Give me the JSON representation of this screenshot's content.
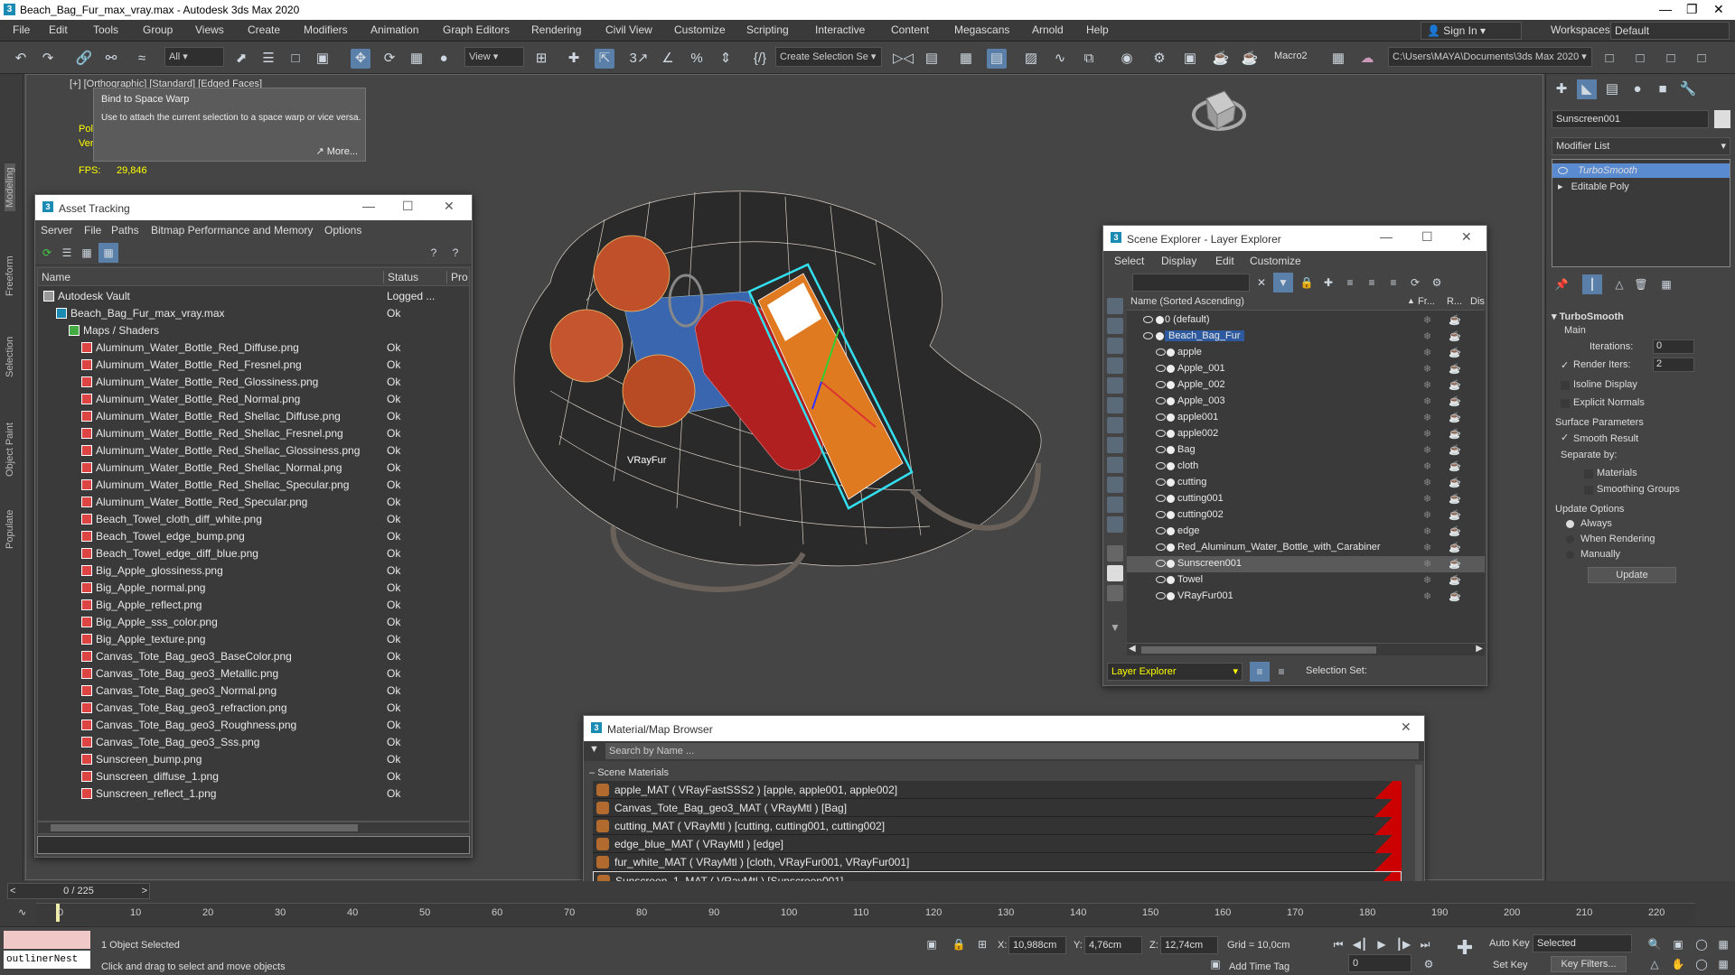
{
  "app": {
    "title": "Beach_Bag_Fur_max_vray.max - Autodesk 3ds Max 2020"
  },
  "menu": [
    "File",
    "Edit",
    "Tools",
    "Group",
    "Views",
    "Create",
    "Modifiers",
    "Animation",
    "Graph Editors",
    "Rendering",
    "Civil View",
    "Customize",
    "Scripting",
    "Interactive",
    "Content",
    "Megascans",
    "Arnold",
    "Help"
  ],
  "account": {
    "sign_in": "Sign In",
    "workspaces_label": "Workspaces:",
    "workspace": "Default"
  },
  "toolbar": {
    "filter": "All",
    "ref_coord": "View",
    "selection_set": "Create Selection Se",
    "macro": "Macro2",
    "path": "C:\\Users\\MAYA\\Documents\\3ds Max 2020"
  },
  "cmd_tabs": [
    "Modeling",
    "Freeform",
    "Selection",
    "Object Paint",
    "Populate"
  ],
  "viewport": {
    "label": "[+] [Orthographic] [Standard] [Edged Faces]",
    "poly_label": "Pol",
    "vert_label": "Ver",
    "fps_label": "FPS:",
    "fps": "29,846",
    "tooltip_title": "Bind to Space Warp",
    "tooltip_body": "Use to attach the current selection to a space warp or vice versa.",
    "tooltip_more": "More...",
    "scene_label": "VRayFur"
  },
  "asset_tracking": {
    "title": "Asset Tracking",
    "menu": [
      "Server",
      "File",
      "Paths",
      "Bitmap Performance and Memory",
      "Options"
    ],
    "columns": [
      "Name",
      "Status",
      "Pro"
    ],
    "rows": [
      {
        "name": "Autodesk Vault",
        "status": "Logged ...",
        "indent": 0,
        "kind": "vault"
      },
      {
        "name": "Beach_Bag_Fur_max_vray.max",
        "status": "Ok",
        "indent": 1,
        "kind": "max"
      },
      {
        "name": "Maps / Shaders",
        "status": "",
        "indent": 2,
        "kind": "folder"
      },
      {
        "name": "Aluminum_Water_Bottle_Red_Diffuse.png",
        "status": "Ok",
        "indent": 3,
        "kind": "file"
      },
      {
        "name": "Aluminum_Water_Bottle_Red_Fresnel.png",
        "status": "Ok",
        "indent": 3,
        "kind": "file"
      },
      {
        "name": "Aluminum_Water_Bottle_Red_Glossiness.png",
        "status": "Ok",
        "indent": 3,
        "kind": "file"
      },
      {
        "name": "Aluminum_Water_Bottle_Red_Normal.png",
        "status": "Ok",
        "indent": 3,
        "kind": "file"
      },
      {
        "name": "Aluminum_Water_Bottle_Red_Shellac_Diffuse.png",
        "status": "Ok",
        "indent": 3,
        "kind": "file"
      },
      {
        "name": "Aluminum_Water_Bottle_Red_Shellac_Fresnel.png",
        "status": "Ok",
        "indent": 3,
        "kind": "file"
      },
      {
        "name": "Aluminum_Water_Bottle_Red_Shellac_Glossiness.png",
        "status": "Ok",
        "indent": 3,
        "kind": "file"
      },
      {
        "name": "Aluminum_Water_Bottle_Red_Shellac_Normal.png",
        "status": "Ok",
        "indent": 3,
        "kind": "file"
      },
      {
        "name": "Aluminum_Water_Bottle_Red_Shellac_Specular.png",
        "status": "Ok",
        "indent": 3,
        "kind": "file"
      },
      {
        "name": "Aluminum_Water_Bottle_Red_Specular.png",
        "status": "Ok",
        "indent": 3,
        "kind": "file"
      },
      {
        "name": "Beach_Towel_cloth_diff_white.png",
        "status": "Ok",
        "indent": 3,
        "kind": "file"
      },
      {
        "name": "Beach_Towel_edge_bump.png",
        "status": "Ok",
        "indent": 3,
        "kind": "file"
      },
      {
        "name": "Beach_Towel_edge_diff_blue.png",
        "status": "Ok",
        "indent": 3,
        "kind": "file"
      },
      {
        "name": "Big_Apple_glossiness.png",
        "status": "Ok",
        "indent": 3,
        "kind": "file"
      },
      {
        "name": "Big_Apple_normal.png",
        "status": "Ok",
        "indent": 3,
        "kind": "file"
      },
      {
        "name": "Big_Apple_reflect.png",
        "status": "Ok",
        "indent": 3,
        "kind": "file"
      },
      {
        "name": "Big_Apple_sss_color.png",
        "status": "Ok",
        "indent": 3,
        "kind": "file"
      },
      {
        "name": "Big_Apple_texture.png",
        "status": "Ok",
        "indent": 3,
        "kind": "file"
      },
      {
        "name": "Canvas_Tote_Bag_geo3_BaseColor.png",
        "status": "Ok",
        "indent": 3,
        "kind": "file"
      },
      {
        "name": "Canvas_Tote_Bag_geo3_Metallic.png",
        "status": "Ok",
        "indent": 3,
        "kind": "file"
      },
      {
        "name": "Canvas_Tote_Bag_geo3_Normal.png",
        "status": "Ok",
        "indent": 3,
        "kind": "file"
      },
      {
        "name": "Canvas_Tote_Bag_geo3_refraction.png",
        "status": "Ok",
        "indent": 3,
        "kind": "file"
      },
      {
        "name": "Canvas_Tote_Bag_geo3_Roughness.png",
        "status": "Ok",
        "indent": 3,
        "kind": "file"
      },
      {
        "name": "Canvas_Tote_Bag_geo3_Sss.png",
        "status": "Ok",
        "indent": 3,
        "kind": "file"
      },
      {
        "name": "Sunscreen_bump.png",
        "status": "Ok",
        "indent": 3,
        "kind": "file"
      },
      {
        "name": "Sunscreen_diffuse_1.png",
        "status": "Ok",
        "indent": 3,
        "kind": "file"
      },
      {
        "name": "Sunscreen_reflect_1.png",
        "status": "Ok",
        "indent": 3,
        "kind": "file"
      }
    ]
  },
  "scene_explorer": {
    "title": "Scene Explorer - Layer Explorer",
    "menu": [
      "Select",
      "Display",
      "Edit",
      "Customize"
    ],
    "col_name": "Name (Sorted Ascending)",
    "col_fr": "Fr...",
    "col_r": "R...",
    "col_disp": "Displa",
    "items": [
      {
        "name": "0 (default)",
        "level": 0,
        "selected": false
      },
      {
        "name": "Beach_Bag_Fur",
        "level": 0,
        "selected": false,
        "highlight": true
      },
      {
        "name": "apple",
        "level": 1,
        "selected": false
      },
      {
        "name": "Apple_001",
        "level": 1,
        "selected": false
      },
      {
        "name": "Apple_002",
        "level": 1,
        "selected": false
      },
      {
        "name": "Apple_003",
        "level": 1,
        "selected": false
      },
      {
        "name": "apple001",
        "level": 1,
        "selected": false
      },
      {
        "name": "apple002",
        "level": 1,
        "selected": false
      },
      {
        "name": "Bag",
        "level": 1,
        "selected": false
      },
      {
        "name": "cloth",
        "level": 1,
        "selected": false
      },
      {
        "name": "cutting",
        "level": 1,
        "selected": false
      },
      {
        "name": "cutting001",
        "level": 1,
        "selected": false
      },
      {
        "name": "cutting002",
        "level": 1,
        "selected": false
      },
      {
        "name": "edge",
        "level": 1,
        "selected": false
      },
      {
        "name": "Red_Aluminum_Water_Bottle_with_Carabiner",
        "level": 1,
        "selected": false
      },
      {
        "name": "Sunscreen001",
        "level": 1,
        "selected": true
      },
      {
        "name": "Towel",
        "level": 1,
        "selected": false
      },
      {
        "name": "VRayFur001",
        "level": 1,
        "selected": false
      }
    ],
    "footer_explorer": "Layer Explorer",
    "footer_selset": "Selection Set:"
  },
  "material_browser": {
    "title": "Material/Map Browser",
    "search_placeholder": "Search by Name ...",
    "section": "Scene Materials",
    "items": [
      "apple_MAT  ( VRayFastSSS2 ) [apple, apple001, apple002]",
      "Canvas_Tote_Bag_geo3_MAT  ( VRayMtl ) [Bag]",
      "cutting_MAT  ( VRayMtl ) [cutting, cutting001, cutting002]",
      "edge_blue_MAT  ( VRayMtl ) [edge]",
      "fur_white_MAT  ( VRayMtl ) [cloth, VRayFur001, VRayFur001]",
      "Sunscreen_1_MAT  ( VRayMtl ) [Sunscreen001]"
    ]
  },
  "command_panel": {
    "object_name": "Sunscreen001",
    "modifier_list": "Modifier List",
    "stack": [
      "TurboSmooth",
      "Editable Poly"
    ],
    "rollout_title": "TurboSmooth",
    "main_label": "Main",
    "iterations_label": "Iterations:",
    "iterations": "0",
    "render_iters_label": "Render Iters:",
    "render_iters": "2",
    "isoline": "Isoline Display",
    "explicit_normals": "Explicit Normals",
    "surface_params": "Surface Parameters",
    "smooth_result": "Smooth Result",
    "separate_by": "Separate by:",
    "materials": "Materials",
    "smoothing_groups": "Smoothing Groups",
    "update_options": "Update Options",
    "always": "Always",
    "when_rendering": "When Rendering",
    "manually": "Manually",
    "update_button": "Update"
  },
  "timeline": {
    "frame": "0 / 225",
    "ticks": [
      "0",
      "10",
      "20",
      "30",
      "40",
      "50",
      "60",
      "70",
      "80",
      "90",
      "100",
      "110",
      "120",
      "130",
      "140",
      "150",
      "160",
      "170",
      "180",
      "190",
      "200",
      "210",
      "220"
    ]
  },
  "status": {
    "maxscript": "outlinerNest",
    "selected": "1 Object Selected",
    "prompt": "Click and drag to select and move objects",
    "x_label": "X:",
    "x": "10,988cm",
    "y_label": "Y:",
    "y": "4,76cm",
    "z_label": "Z:",
    "z": "12,74cm",
    "grid": "Grid = 10,0cm",
    "add_time_tag": "Add Time Tag",
    "auto_key": "Auto Key",
    "set_key": "Set Key",
    "selected_set": "Selected",
    "key_filters": "Key Filters...",
    "frame_field": "0"
  }
}
